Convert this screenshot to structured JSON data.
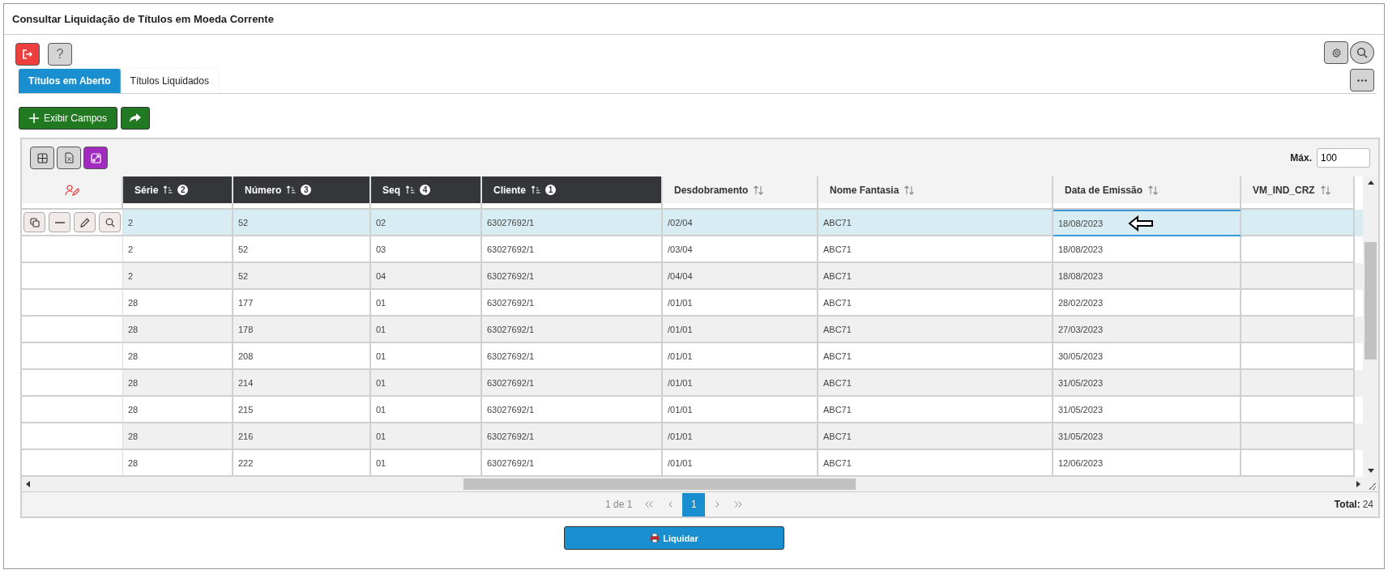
{
  "window": {
    "title": "Consultar Liquidação de Títulos em Moeda Corrente"
  },
  "tabs": [
    {
      "label": "Títulos em Aberto",
      "selected": true
    },
    {
      "label": "Títulos Liquidados",
      "selected": false
    }
  ],
  "help_button": "?",
  "toolbar": {
    "show_fields_button": "Exibir Campos"
  },
  "grid": {
    "max_label": "Máx.",
    "max_value": "100",
    "columns": [
      {
        "label": "Série",
        "sorted": true,
        "sort_order": "2"
      },
      {
        "label": "Número",
        "sorted": true,
        "sort_order": "3"
      },
      {
        "label": "Seq",
        "sorted": true,
        "sort_order": "4"
      },
      {
        "label": "Cliente",
        "sorted": true,
        "sort_order": "1"
      },
      {
        "label": "Desdobramento",
        "sorted": false
      },
      {
        "label": "Nome Fantasia",
        "sorted": false
      },
      {
        "label": "Data de Emissão",
        "sorted": false
      },
      {
        "label": "VM_IND_CRZ",
        "sorted": false
      }
    ],
    "rows": [
      {
        "selected": true,
        "cells": [
          "2",
          "52",
          "02",
          "63027692/1",
          "/02/04",
          "ABC71",
          "18/08/2023",
          ""
        ]
      },
      {
        "selected": false,
        "cells": [
          "2",
          "52",
          "03",
          "63027692/1",
          "/03/04",
          "ABC71",
          "18/08/2023",
          ""
        ]
      },
      {
        "selected": false,
        "cells": [
          "2",
          "52",
          "04",
          "63027692/1",
          "/04/04",
          "ABC71",
          "18/08/2023",
          ""
        ]
      },
      {
        "selected": false,
        "cells": [
          "28",
          "177",
          "01",
          "63027692/1",
          "/01/01",
          "ABC71",
          "28/02/2023",
          ""
        ]
      },
      {
        "selected": false,
        "cells": [
          "28",
          "178",
          "01",
          "63027692/1",
          "/01/01",
          "ABC71",
          "27/03/2023",
          ""
        ]
      },
      {
        "selected": false,
        "cells": [
          "28",
          "208",
          "01",
          "63027692/1",
          "/01/01",
          "ABC71",
          "30/05/2023",
          ""
        ]
      },
      {
        "selected": false,
        "cells": [
          "28",
          "214",
          "01",
          "63027692/1",
          "/01/01",
          "ABC71",
          "31/05/2023",
          ""
        ]
      },
      {
        "selected": false,
        "cells": [
          "28",
          "215",
          "01",
          "63027692/1",
          "/01/01",
          "ABC71",
          "31/05/2023",
          ""
        ]
      },
      {
        "selected": false,
        "cells": [
          "28",
          "216",
          "01",
          "63027692/1",
          "/01/01",
          "ABC71",
          "31/05/2023",
          ""
        ]
      },
      {
        "selected": false,
        "cells": [
          "28",
          "222",
          "01",
          "63027692/1",
          "/01/01",
          "ABC71",
          "12/06/2023",
          ""
        ]
      }
    ],
    "pager": {
      "page_info": "1 de 1",
      "current_page": "1",
      "total_label": "Total:",
      "total_value": "24"
    }
  },
  "action_button": "Liquidar"
}
